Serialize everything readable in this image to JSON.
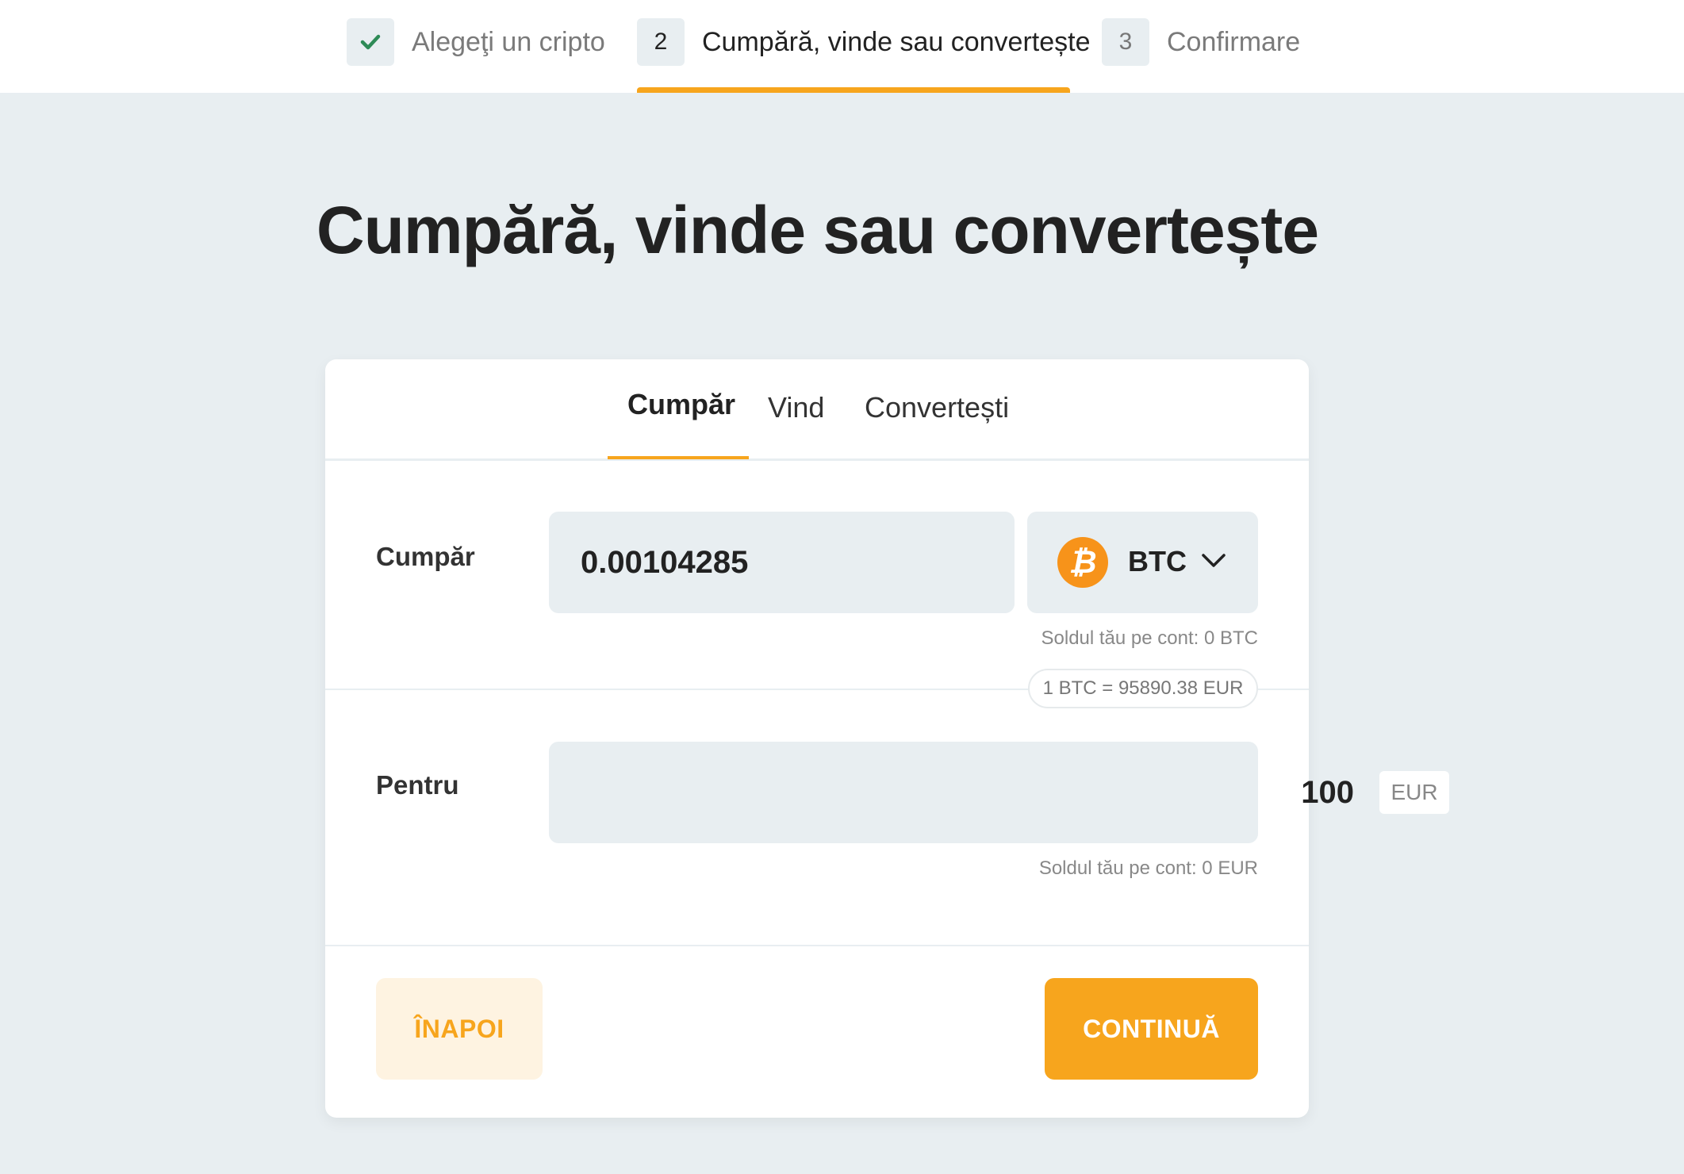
{
  "stepper": {
    "steps": [
      {
        "number": "✔",
        "label": "Alegeţi un cripto",
        "state": "done"
      },
      {
        "number": "2",
        "label": "Cumpără, vinde sau convertește",
        "state": "active"
      },
      {
        "number": "3",
        "label": "Confirmare",
        "state": "pending"
      }
    ]
  },
  "page": {
    "title": "Cumpără, vinde sau convertește"
  },
  "tabs": [
    {
      "label": "Cumpăr",
      "active": true
    },
    {
      "label": "Vind",
      "active": false
    },
    {
      "label": "Convertești",
      "active": false
    }
  ],
  "buy": {
    "label": "Cumpăr",
    "amount": "0.00104285",
    "crypto": {
      "code": "BTC",
      "icon": "bitcoin-icon",
      "icon_symbol": "₿",
      "color": "#f7931a"
    },
    "balance_hint": "Soldul tău pe cont: 0 BTC"
  },
  "rate": {
    "text": "1 BTC = 95890.38 EUR"
  },
  "pay": {
    "label": "Pentru",
    "amount": "100",
    "currency": "EUR",
    "balance_hint": "Soldul tău pe cont: 0 EUR"
  },
  "actions": {
    "back_label": "ÎNAPOI",
    "continue_label": "CONTINUĂ"
  },
  "colors": {
    "accent": "#f7a51d",
    "background": "#e8eef1",
    "check": "#2e8b57"
  }
}
